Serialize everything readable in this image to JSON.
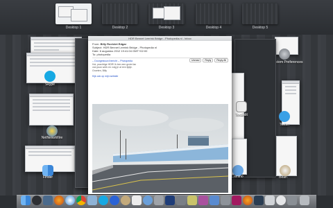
{
  "spaces": {
    "desktops": [
      {
        "label": "Desktop 1"
      },
      {
        "label": "Desktop 2"
      },
      {
        "label": "Desktop 3"
      },
      {
        "label": "Desktop 4"
      },
      {
        "label": "Desktop 5"
      }
    ]
  },
  "apps": {
    "skype": "Skype",
    "netnewswire": "NetNewsWire",
    "finder": "Finder",
    "system_prefs": "System Preferences",
    "textedit": "TextEdit",
    "twitter": "Twitter",
    "camino": "Camino",
    "bean": "Bean"
  },
  "mail": {
    "window_title": "HDR Bennet Leerink Bridge - Photopedia.nl - Inbox",
    "from_label": "From:",
    "from_value": "Billy Roeiviet Edgar",
    "subject_label": "Subject:",
    "subject_value": "HDR Bennet Leerink Bridge - Photopedia nl",
    "date_label": "Date:",
    "date_value": "6 augustus 2012 19:41:04 GMT+02:00",
    "to_label": "To:",
    "to_value": "photopedia",
    "toolbar": [
      "Unread",
      "Reply",
      "Reply All"
    ],
    "body_lines": [
      "-- Doorgestuurd bericht -- Photopedia",
      "Hoi, prachtige HDR! Ik ben een grote fan",
      "van jouw werk en volg je al een tijdje.",
      "Groeten, Billy",
      "",
      "Kijk ook op mijn website"
    ]
  }
}
